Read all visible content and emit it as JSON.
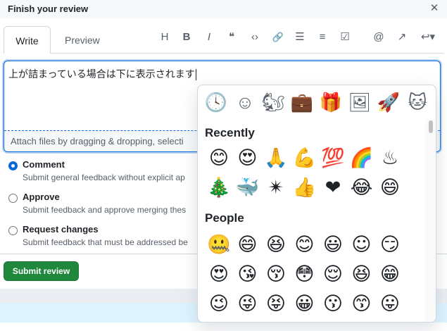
{
  "dialog": {
    "title": "Finish your review",
    "close_glyph": "✕"
  },
  "tabs": [
    {
      "label": "Write"
    },
    {
      "label": "Preview"
    }
  ],
  "toolbar": {
    "heading": "H",
    "bold": "B",
    "italic": "I",
    "quote": "❝",
    "code": "‹›",
    "link": "🔗",
    "bullet_list": "☰",
    "numbered_list": "≡",
    "task_list": "☑",
    "mention": "@",
    "reference": "↗",
    "reply": "↩▾"
  },
  "editor": {
    "text": "上が詰まっている場合は下に表示されます",
    "attach_text": "Attach files by dragging & dropping, selecti"
  },
  "options": [
    {
      "label": "Comment",
      "desc": "Submit general feedback without explicit ap",
      "checked": true
    },
    {
      "label": "Approve",
      "desc": "Submit feedback and approve merging thes",
      "checked": false
    },
    {
      "label": "Request changes",
      "desc": "Submit feedback that must be addressed be",
      "checked": false
    }
  ],
  "submit_label": "Submit review",
  "emoji_picker": {
    "categories": [
      "🕓",
      "☺",
      "🐿",
      "💼",
      "🎁",
      "🖼",
      "🚀",
      "🐱"
    ],
    "sections": [
      {
        "title": "Recently",
        "rows": [
          [
            "😊",
            "😍",
            "🙏",
            "💪",
            "💯",
            "🌈",
            "♨"
          ],
          [
            "🎄",
            "🐳",
            "✴",
            "👍",
            "❤",
            "😂",
            "😄"
          ]
        ]
      },
      {
        "title": "People",
        "rows": [
          [
            "🤐",
            "😄",
            "😆",
            "😊",
            "😃",
            "☺",
            "😏"
          ],
          [
            "😍",
            "😘",
            "😚",
            "😳",
            "😌",
            "😆",
            "😁"
          ],
          [
            "😉",
            "😜",
            "😝",
            "😀",
            "😗",
            "😙",
            "😛"
          ]
        ]
      }
    ]
  },
  "colors": {
    "accent": "#0969da",
    "submit": "#1f883d",
    "band": "#ddf4ff"
  }
}
